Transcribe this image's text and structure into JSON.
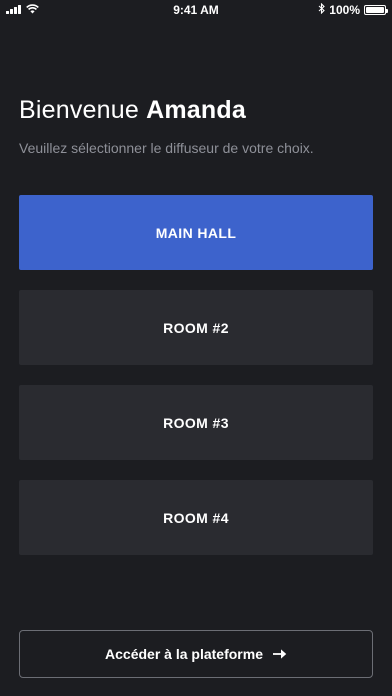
{
  "status_bar": {
    "time": "9:41 AM",
    "battery_percent": "100%",
    "battery_level": 1.0
  },
  "header": {
    "greeting_prefix": "Bienvenue",
    "user_name": "Amanda",
    "subtitle": "Veuillez sélectionner le diffuseur de votre choix."
  },
  "rooms": [
    {
      "label": "MAIN HALL",
      "selected": true
    },
    {
      "label": "ROOM #2",
      "selected": false
    },
    {
      "label": "ROOM #3",
      "selected": false
    },
    {
      "label": "ROOM #4",
      "selected": false
    }
  ],
  "cta": {
    "label": "Accéder à la plateforme",
    "icon": "arrow-right-icon"
  },
  "colors": {
    "background": "#1c1d21",
    "card": "#2a2b30",
    "accent": "#3d63cc",
    "muted_text": "#8e9098"
  }
}
